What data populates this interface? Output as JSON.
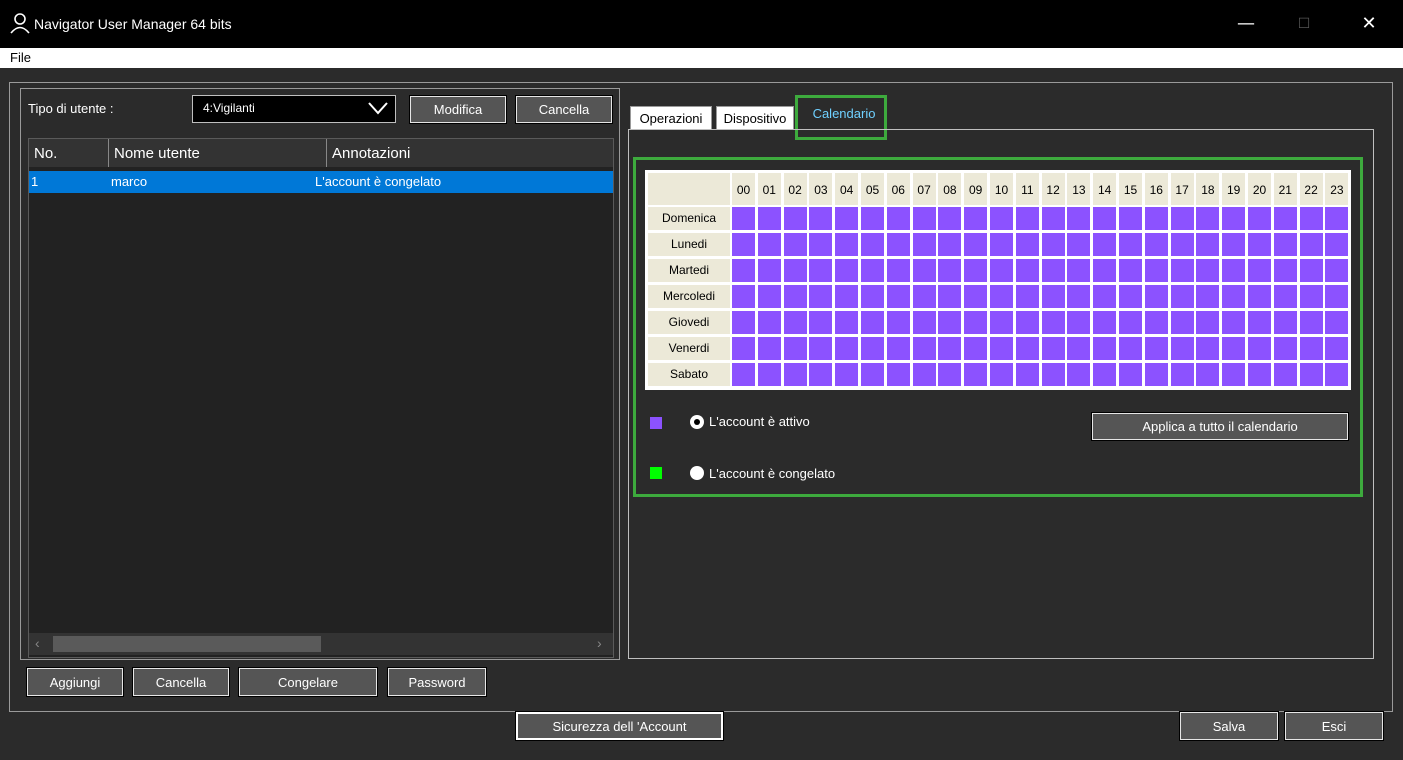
{
  "window": {
    "title": "Navigator User Manager 64 bits",
    "minimize": "—",
    "maximize": "☐",
    "close": "✕"
  },
  "menu": {
    "file": "File"
  },
  "user_type": {
    "label": "Tipo di utente :",
    "selected": "4:Vigilanti",
    "modify_button": "Modifica",
    "delete_button": "Cancella"
  },
  "user_table": {
    "columns": [
      "No.",
      "Nome utente",
      "Annotazioni"
    ],
    "rows": [
      {
        "no": "1",
        "name": "marco",
        "note": "L'account è congelato",
        "selected": true
      }
    ]
  },
  "list_buttons": {
    "add": "Aggiungi",
    "delete": "Cancella",
    "freeze": "Congelare",
    "password": "Password"
  },
  "tabs": {
    "operations": "Operazioni",
    "device": "Dispositivo",
    "calendar": "Calendario",
    "active": "Calendario"
  },
  "calendar": {
    "hours": [
      "00",
      "01",
      "02",
      "03",
      "04",
      "05",
      "06",
      "07",
      "08",
      "09",
      "10",
      "11",
      "12",
      "13",
      "14",
      "15",
      "16",
      "17",
      "18",
      "19",
      "20",
      "21",
      "22",
      "23"
    ],
    "days": [
      "Domenica",
      "Lunedi",
      "Martedi",
      "Mercoledi",
      "Giovedi",
      "Venerdi",
      "Sabato"
    ],
    "slot_state": "active",
    "active_color": "#8c52ff",
    "frozen_color": "#00ff00"
  },
  "legend": {
    "active_label": "L'account è attivo",
    "frozen_label": "L'account è congelato",
    "selected": "active"
  },
  "apply_button": "Applica a tutto il calendario",
  "footer": {
    "security_button": "Sicurezza dell 'Account",
    "save_button": "Salva",
    "exit_button": "Esci"
  },
  "colors": {
    "selection": "#0078d7",
    "highlight_frame": "#3daa3d",
    "active_tab_text": "#6fd0ff"
  }
}
